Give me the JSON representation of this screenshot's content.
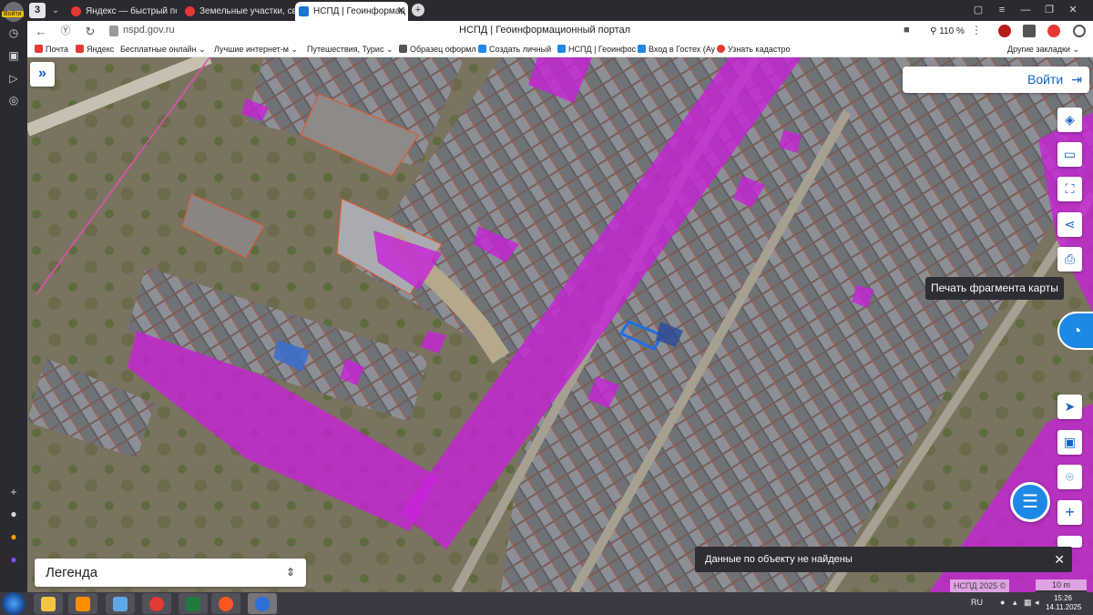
{
  "rail": {
    "avatar_badge": "Войти",
    "items": [
      "history-icon",
      "collections-icon",
      "play-icon",
      "alice-icon"
    ]
  },
  "tabs": {
    "count": "3",
    "items": [
      {
        "label": "Яндекс — быстрый поиск",
        "active": false
      },
      {
        "label": "Земельные участки, своб",
        "active": false
      },
      {
        "label": "НСПД | Геоинформац",
        "active": true
      }
    ],
    "close": "✕",
    "new_tab": "+"
  },
  "window_controls": [
    "bookmarks-icon",
    "menu-icon",
    "minimize-icon",
    "restore-icon",
    "close-icon"
  ],
  "address": {
    "url": "nspd.gov.ru",
    "page_title": "НСПД | Геоинформационный портал",
    "zoom": "110 %",
    "more": "⋮"
  },
  "bookmarks": {
    "items": [
      {
        "label": "Почта",
        "color": "#e53935"
      },
      {
        "label": "Яндекс",
        "color": "#e53935"
      },
      {
        "label": "Бесплатные онлайн",
        "color": "#ffffff"
      },
      {
        "label": "Лучшие интернет-м",
        "color": "#ffffff"
      },
      {
        "label": "Путешествия, Турис",
        "color": "#ffffff"
      },
      {
        "label": "Образец оформл",
        "color": "#555555"
      },
      {
        "label": "Создать личный",
        "color": "#1e88e5"
      },
      {
        "label": "НСПД | Геоинфос",
        "color": "#1e88e5"
      },
      {
        "label": "Вход в Гостех (Ау",
        "color": "#1e88e5"
      },
      {
        "label": "Узнать кадастро",
        "color": "#e53935"
      }
    ],
    "other": "Другие закладки"
  },
  "map": {
    "login_label": "Войти",
    "tools": [
      "layers-icon",
      "ruler-icon",
      "select-area-icon",
      "share-icon",
      "print-icon"
    ],
    "tooltip": "Печать фрагмента карты",
    "lower_tools": [
      "locate-icon",
      "minimap-icon",
      "geo-search-icon",
      "zoom-in-icon",
      "zoom-out-icon"
    ],
    "zoom_in": "+",
    "legend_label": "Легенда",
    "toast": "Данные по объекту не найдены",
    "toast_close": "✕",
    "attribution": "НСПД 2025 ©",
    "scale": "10 m"
  },
  "taskbar": {
    "apps": [
      "explorer",
      "media-player",
      "volume",
      "chrome",
      "excel",
      "browser",
      "yandex-browser"
    ],
    "lang": "RU",
    "time": "15:26",
    "date": "14.11.2025"
  },
  "colors": {
    "accent": "#1565c0",
    "parcel_fill": "#c822d8",
    "parcel_line": "#e0542a",
    "selection": "#1e6fe0"
  }
}
